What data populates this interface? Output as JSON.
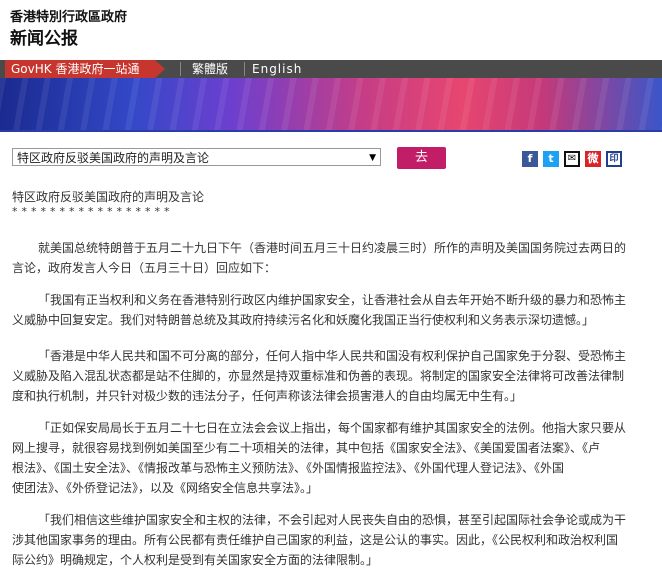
{
  "header": {
    "gov_name": "香港特別行政區政府",
    "section": "新闻公报"
  },
  "nav": {
    "gov_portal": "GovHK 香港政府一站通",
    "traditional": "繁體版",
    "english": "English"
  },
  "selector": {
    "selected": "特区政府反驳美国政府的声明及言论",
    "go_label": "去"
  },
  "share": {
    "facebook": "f",
    "twitter": "t",
    "email": "✉",
    "weibo": "微",
    "print": "印"
  },
  "article": {
    "title": "特区政府反驳美国政府的声明及言论",
    "stars": "*****************",
    "intro_line1": "就美国总统特朗普于五月二十九日下午（香港时间五月三十日约凌晨三时）所作的声明及美国国务院过去两日的",
    "intro_line2": "言论，政府发言人今日（五月三十日）回应如下：",
    "quotes": [
      {
        "line1": "「我国有正当权利和义务在香港特别行政区内维护国家安全，让香港社会从自去年开始不断升级的暴力和恐怖主",
        "line2": "义威胁中回复安定。我们对特朗普总统及其政府持续污名化和妖魔化我国正当行使权利和义务表示深切遗憾。」"
      },
      {
        "line1": "「香港是中华人民共和国不可分离的部分，任何人指中华人民共和国没有权利保护自己国家免于分裂、受恐怖主",
        "line2": "义威胁及陷入混乱状态都是站不住脚的，亦显然是持双重标准和伪善的表现。将制定的国家安全法律将可改善法律制",
        "line3": "度和执行机制，并只针对极少数的违法分子，任何声称该法律会损害港人的自由均属无中生有。」"
      },
      {
        "line1": "「正如保安局局长于五月二十七日在立法会会议上指出，每个国家都有维护其国家安全的法例。他指大家只要从",
        "line2": "网上搜寻，就很容易找到例如美国至少有二十项相关的法律，其中包括《国家安全法》、《美国爱国者法案》、《卢",
        "line3": "根法》、《国土安全法》、《情报改革与恐怖主义预防法》、《外国情报监控法》、《外国代理人登记法》、《外国",
        "line4": "使团法》、《外侨登记法》，以及《网络安全信息共享法》。」"
      },
      {
        "line1": "「我们相信这些维护国家安全和主权的法律，不会引起对人民丧失自由的恐惧，甚至引起国际社会争论或成为干",
        "line2": "涉其他国家事务的理由。所有公民都有责任维护自己国家的利益，这是公认的事实。因此，《公民权利和政治权利国",
        "line3": "际公约》明确规定，个人权利是受到有关国家安全方面的法律限制。」"
      }
    ]
  }
}
